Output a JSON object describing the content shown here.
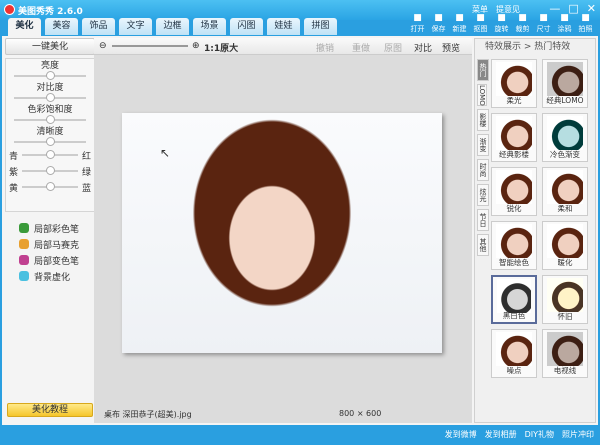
{
  "app": {
    "title": "美图秀秀 2.6.0",
    "links": [
      "菜单",
      "提意见"
    ],
    "controls": [
      "—",
      "□",
      "✕"
    ]
  },
  "tabs": [
    "美化",
    "美容",
    "饰品",
    "文字",
    "边框",
    "场景",
    "闪图",
    "娃娃",
    "拼图"
  ],
  "tools": [
    {
      "label": "打开",
      "icon": "folder-icon"
    },
    {
      "label": "保存",
      "icon": "save-icon"
    },
    {
      "label": "新建",
      "icon": "plus-icon"
    },
    {
      "label": "抠图",
      "icon": "cutout-icon"
    },
    {
      "label": "旋转",
      "icon": "rotate-icon"
    },
    {
      "label": "裁剪",
      "icon": "crop-icon"
    },
    {
      "label": "尺寸",
      "icon": "resize-icon"
    },
    {
      "label": "涂鸦",
      "icon": "brush-icon"
    },
    {
      "label": "拍照",
      "icon": "camera-icon"
    }
  ],
  "left": {
    "one_click": "一键美化",
    "adjust": [
      "亮度",
      "对比度",
      "色彩饱和度",
      "清晰度"
    ],
    "adjust_values": [
      0.5,
      0.5,
      0.5,
      0.5
    ],
    "color_balance": [
      {
        "l": "青",
        "r": "红",
        "value": 0.5
      },
      {
        "l": "紫",
        "r": "绿",
        "value": 0.5
      },
      {
        "l": "黄",
        "r": "蓝",
        "value": 0.5
      }
    ],
    "tools": [
      "局部彩色笔",
      "局部马赛克",
      "局部变色笔",
      "背景虚化"
    ],
    "tutorial": "美化教程"
  },
  "canvas": {
    "zoom_label": "1:1原大",
    "undo": "撤销",
    "redo": "重做",
    "original": "原图",
    "compare": "对比",
    "preview": "预览",
    "filename": "桌布 深田恭子(超美).jpg",
    "dimensions": "800 × 600"
  },
  "right": {
    "breadcrumb": "特效展示 > 热门特效",
    "vtabs": [
      "热门",
      "LOMO",
      "影楼",
      "渐变",
      "时尚",
      "炫光",
      "节日",
      "其他"
    ],
    "effects": [
      "柔光",
      "经典LOMO",
      "经典影楼",
      "冷色渐变",
      "锐化",
      "柔和",
      "智能绘色",
      "暖化",
      "黑白色",
      "怀旧",
      "噪点",
      "电视线"
    ],
    "selected": "黑白色"
  },
  "status": [
    "发到微博",
    "发到相册",
    "DIY礼物",
    "照片冲印"
  ]
}
